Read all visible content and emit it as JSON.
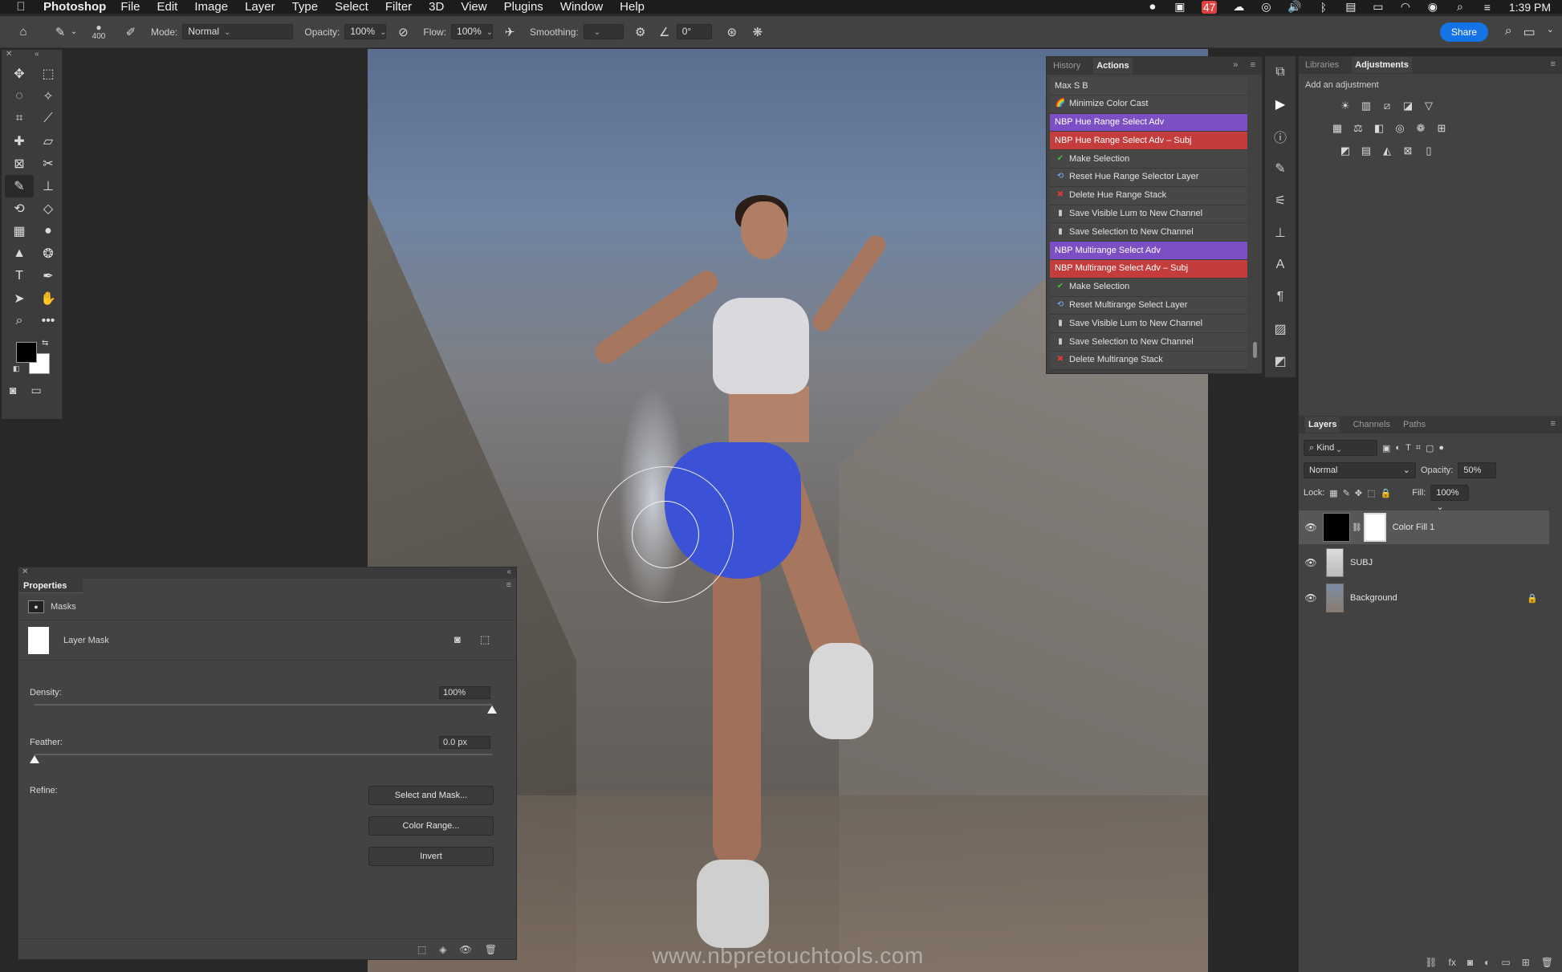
{
  "menubar": {
    "app": "Photoshop",
    "menus": [
      "File",
      "Edit",
      "Image",
      "Layer",
      "Type",
      "Select",
      "Filter",
      "3D",
      "View",
      "Plugins",
      "Window",
      "Help"
    ],
    "badge": "47",
    "clock": "1:39 PM"
  },
  "options": {
    "brush_size": "400",
    "mode_label": "Mode:",
    "mode_value": "Normal",
    "opacity_label": "Opacity:",
    "opacity_value": "100%",
    "flow_label": "Flow:",
    "flow_value": "100%",
    "smoothing_label": "Smoothing:",
    "smoothing_value": "",
    "angle_value": "0°",
    "share_label": "Share"
  },
  "canvas": {
    "watermark": "www.nbpretouchtools.com"
  },
  "actions_panel": {
    "tabs": [
      "History",
      "Actions"
    ],
    "items": [
      {
        "label": "Max S B",
        "icon": "",
        "style": "plain"
      },
      {
        "label": "Minimize Color Cast",
        "icon": "rainbow-icon",
        "style": "plain"
      },
      {
        "label": "NBP Hue Range Select Adv",
        "icon": "",
        "style": "purple"
      },
      {
        "label": "NBP Hue Range Select Adv – Subj",
        "icon": "",
        "style": "red"
      },
      {
        "label": "Make Selection",
        "icon": "check-icon",
        "style": "plain"
      },
      {
        "label": "Reset Hue Range Selector Layer",
        "icon": "reset-icon",
        "style": "plain"
      },
      {
        "label": "Delete Hue Range Stack",
        "icon": "x-icon",
        "style": "plain"
      },
      {
        "label": "Save Visible Lum to New Channel",
        "icon": "save-icon",
        "style": "plain"
      },
      {
        "label": "Save Selection to New Channel",
        "icon": "save-icon",
        "style": "plain"
      },
      {
        "label": "NBP Multirange Select Adv",
        "icon": "",
        "style": "purple"
      },
      {
        "label": "NBP Multirange Select Adv – Subj",
        "icon": "",
        "style": "red"
      },
      {
        "label": "Make Selection",
        "icon": "check-icon",
        "style": "plain"
      },
      {
        "label": "Reset Multirange Select Layer",
        "icon": "reset-icon",
        "style": "plain"
      },
      {
        "label": "Save Visible Lum to New Channel",
        "icon": "save-icon",
        "style": "plain"
      },
      {
        "label": "Save Selection to New Channel",
        "icon": "save-icon",
        "style": "plain"
      },
      {
        "label": "Delete Multirange Stack",
        "icon": "x-icon",
        "style": "plain"
      }
    ]
  },
  "adjustments_panel": {
    "tabs": [
      "Libraries",
      "Adjustments"
    ],
    "hint": "Add an adjustment"
  },
  "layers_panel": {
    "tabs": [
      "Layers",
      "Channels",
      "Paths"
    ],
    "kind": "Kind",
    "blend_mode": "Normal",
    "opacity_label": "Opacity:",
    "opacity_value": "50%",
    "lock_label": "Lock:",
    "fill_label": "Fill:",
    "fill_value": "100%",
    "layers": [
      {
        "name": "Color Fill 1",
        "selected": true
      },
      {
        "name": "SUBJ",
        "selected": false
      },
      {
        "name": "Background",
        "selected": false,
        "locked": true
      }
    ]
  },
  "properties_panel": {
    "title": "Properties",
    "section": "Masks",
    "mask_label": "Layer Mask",
    "density_label": "Density:",
    "density_value": "100%",
    "density_level": 1.0,
    "feather_label": "Feather:",
    "feather_value": "0.0 px",
    "feather_level": 0.0,
    "refine_label": "Refine:",
    "buttons": [
      "Select and Mask...",
      "Color Range...",
      "Invert"
    ]
  },
  "colors": {
    "purple_action": "#7d4fc4",
    "red_action": "#c53c3c",
    "share_blue": "#1473e6"
  }
}
